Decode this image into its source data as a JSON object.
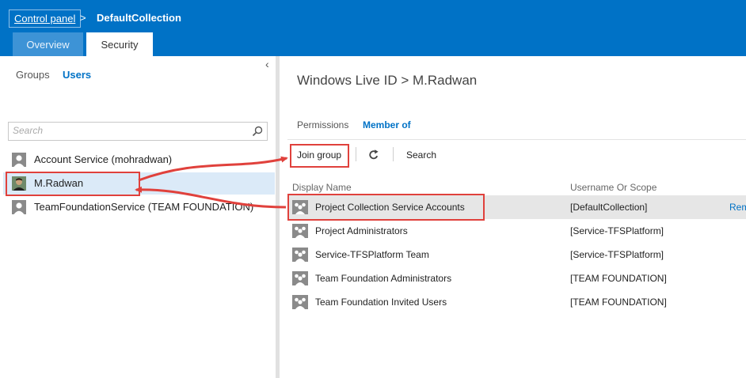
{
  "breadcrumb": {
    "control_panel": "Control panel",
    "separator": ">",
    "current": "DefaultCollection"
  },
  "tabs": {
    "overview": "Overview",
    "security": "Security"
  },
  "left_pane": {
    "collapse_glyph": "‹",
    "tabs": {
      "groups": "Groups",
      "users": "Users"
    },
    "search_placeholder": "Search",
    "users": [
      {
        "name": "Account Service (mohradwan)"
      },
      {
        "name": "M.Radwan"
      },
      {
        "name": "TeamFoundationService (TEAM FOUNDATION)"
      }
    ]
  },
  "right_pane": {
    "title": "Windows Live ID > M.Radwan",
    "tabs": {
      "permissions": "Permissions",
      "member_of": "Member of"
    },
    "toolbar": {
      "join_group": "Join group",
      "search": "Search"
    },
    "columns": {
      "display_name": "Display Name",
      "scope": "Username Or Scope"
    },
    "groups": [
      {
        "name": "Project Collection Service Accounts",
        "scope": "[DefaultCollection]",
        "action": "Rem"
      },
      {
        "name": "Project Administrators",
        "scope": "[Service-TFSPlatform]"
      },
      {
        "name": "Service-TFSPlatform Team",
        "scope": "[Service-TFSPlatform]"
      },
      {
        "name": "Team Foundation Administrators",
        "scope": "[TEAM FOUNDATION]"
      },
      {
        "name": "Team Foundation Invited Users",
        "scope": "[TEAM FOUNDATION]"
      }
    ]
  },
  "colors": {
    "brand": "#0072c6",
    "highlight": "#e0413c",
    "selection": "#dbeaf8"
  }
}
